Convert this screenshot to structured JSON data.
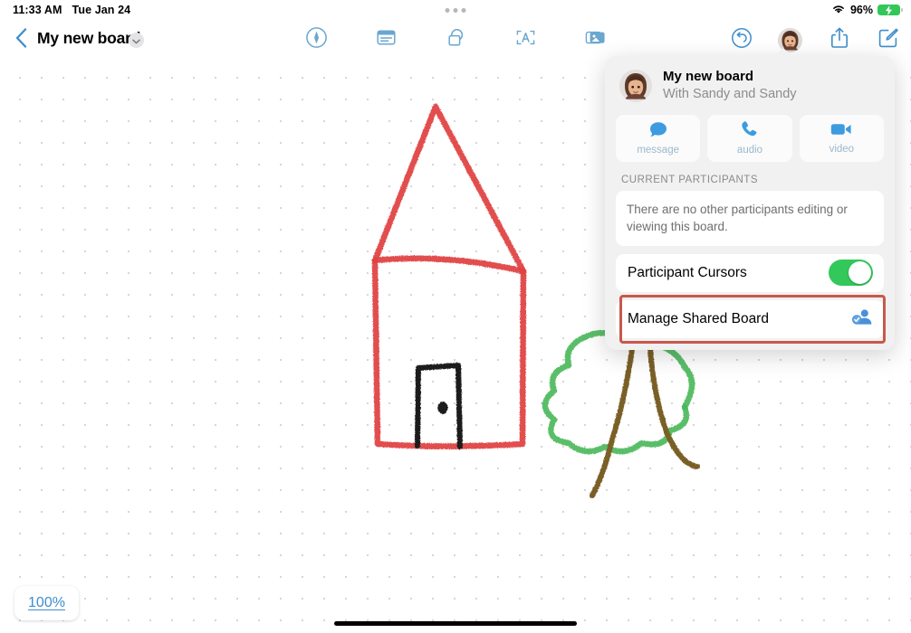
{
  "status_bar": {
    "time": "11:33 AM",
    "date": "Tue Jan 24",
    "battery_percent": "96%",
    "wifi_icon": "wifi-icon",
    "battery_icon": "battery-charging-icon",
    "multitask_dots_icon": "multitasking-dots-icon"
  },
  "nav": {
    "back_icon": "chevron-left-icon",
    "title": "My new board",
    "title_chevron_icon": "chevron-down-icon",
    "tools": [
      {
        "name": "markup-pen-tool",
        "icon": "pen-circle-icon"
      },
      {
        "name": "sticky-note-tool",
        "icon": "note-icon"
      },
      {
        "name": "shapes-tool",
        "icon": "shapes-icon"
      },
      {
        "name": "text-box-tool",
        "icon": "text-box-icon"
      },
      {
        "name": "media-tool",
        "icon": "photos-icon"
      }
    ],
    "right_tools": [
      {
        "name": "undo-button",
        "icon": "undo-icon"
      },
      {
        "name": "collaboration-avatar-button",
        "icon": "avatar-icon"
      },
      {
        "name": "share-button",
        "icon": "share-icon"
      },
      {
        "name": "compose-button",
        "icon": "compose-icon"
      }
    ]
  },
  "popover": {
    "board_title": "My new board",
    "board_subtitle": "With Sandy and Sandy",
    "actions": [
      {
        "label": "message",
        "icon": "message-bubble-icon"
      },
      {
        "label": "audio",
        "icon": "phone-icon"
      },
      {
        "label": "video",
        "icon": "video-camera-icon"
      }
    ],
    "participants_header": "CURRENT PARTICIPANTS",
    "participants_empty": "There are no other participants editing or viewing this board.",
    "cursors_row": {
      "label": "Participant Cursors",
      "toggle_on": true
    },
    "manage_row": {
      "label": "Manage Shared Board",
      "icon": "person-check-icon"
    }
  },
  "canvas": {
    "zoom_level": "100%",
    "drawing_description": "Crayon drawing of a red house with a black door and a green tree with a brown trunk",
    "colors": {
      "house": "#e0403f",
      "door": "#1a1a1a",
      "foliage": "#4cb85c",
      "trunk": "#7a6126"
    }
  },
  "annotation": {
    "highlight_color": "#c8584c",
    "target": "Manage Shared Board"
  }
}
